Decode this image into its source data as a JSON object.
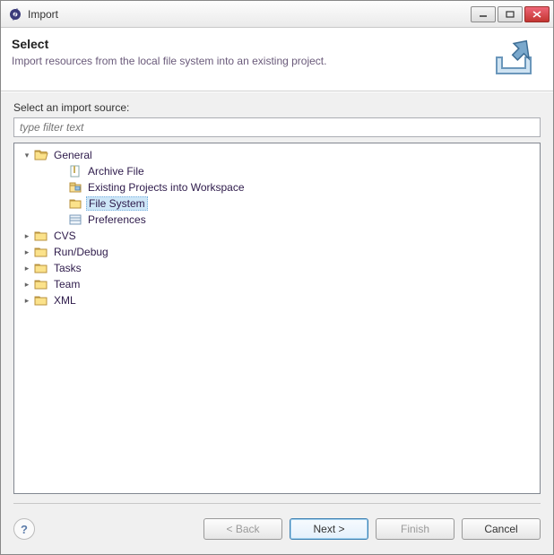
{
  "window": {
    "title": "Import"
  },
  "header": {
    "title": "Select",
    "description": "Import resources from the local file system into an existing project."
  },
  "body": {
    "source_label": "Select an import source:",
    "filter_placeholder": "type filter text"
  },
  "tree": {
    "general": {
      "label": "General",
      "children": {
        "archive": "Archive File",
        "existing": "Existing Projects into Workspace",
        "filesystem": "File System",
        "preferences": "Preferences"
      }
    },
    "cvs": {
      "label": "CVS"
    },
    "rundebug": {
      "label": "Run/Debug"
    },
    "tasks": {
      "label": "Tasks"
    },
    "team": {
      "label": "Team"
    },
    "xml": {
      "label": "XML"
    }
  },
  "buttons": {
    "back": "< Back",
    "next": "Next >",
    "finish": "Finish",
    "cancel": "Cancel"
  }
}
